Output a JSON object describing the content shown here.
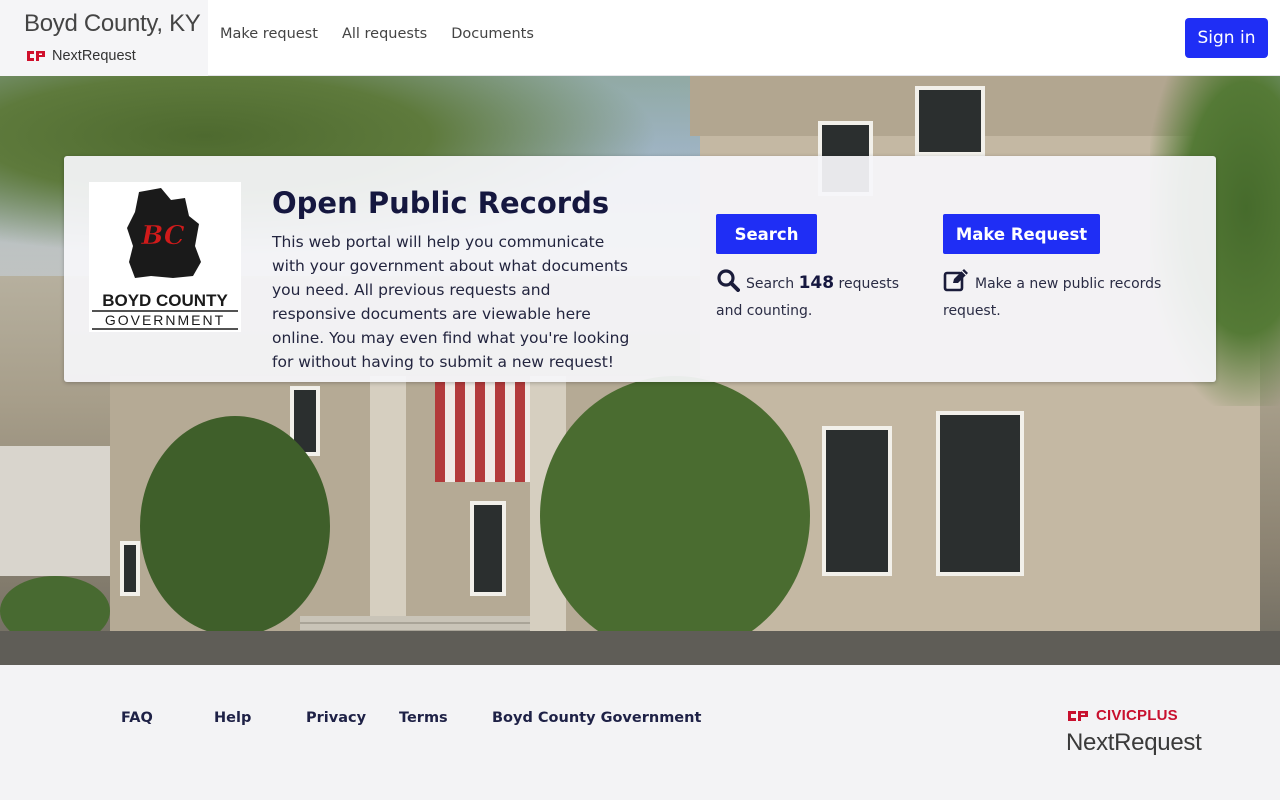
{
  "header": {
    "org_name": "Boyd County, KY",
    "product_name": "NextRequest",
    "nav": [
      {
        "label": "Make request"
      },
      {
        "label": "All requests"
      },
      {
        "label": "Documents"
      }
    ],
    "sign_in_label": "Sign in"
  },
  "hero": {
    "logo": {
      "monogram": "BC",
      "line1": "BOYD COUNTY",
      "line2": "GOVERNMENT"
    },
    "title": "Open Public Records",
    "description": "This web portal will help you communicate with your government about what documents you need. All previous requests and responsive documents are viewable here online. You may even find what you're looking for without having to submit a new request!",
    "search": {
      "button_label": "Search",
      "icon": "search-icon",
      "text_before": "Search",
      "count": "148",
      "text_after": "requests and counting."
    },
    "make_request": {
      "button_label": "Make Request",
      "icon": "edit-icon",
      "text": "Make a new public records request."
    }
  },
  "footer": {
    "links": [
      {
        "label": "FAQ"
      },
      {
        "label": "Help"
      },
      {
        "label": "Privacy"
      },
      {
        "label": "Terms"
      },
      {
        "label": "Boyd County Government"
      }
    ],
    "civicplus_label": "CIVICPLUS",
    "nextrequest_label": "NextRequest"
  },
  "colors": {
    "accent": "#1f2ef5",
    "title": "#15173f",
    "civicplus_red": "#c8102e"
  }
}
